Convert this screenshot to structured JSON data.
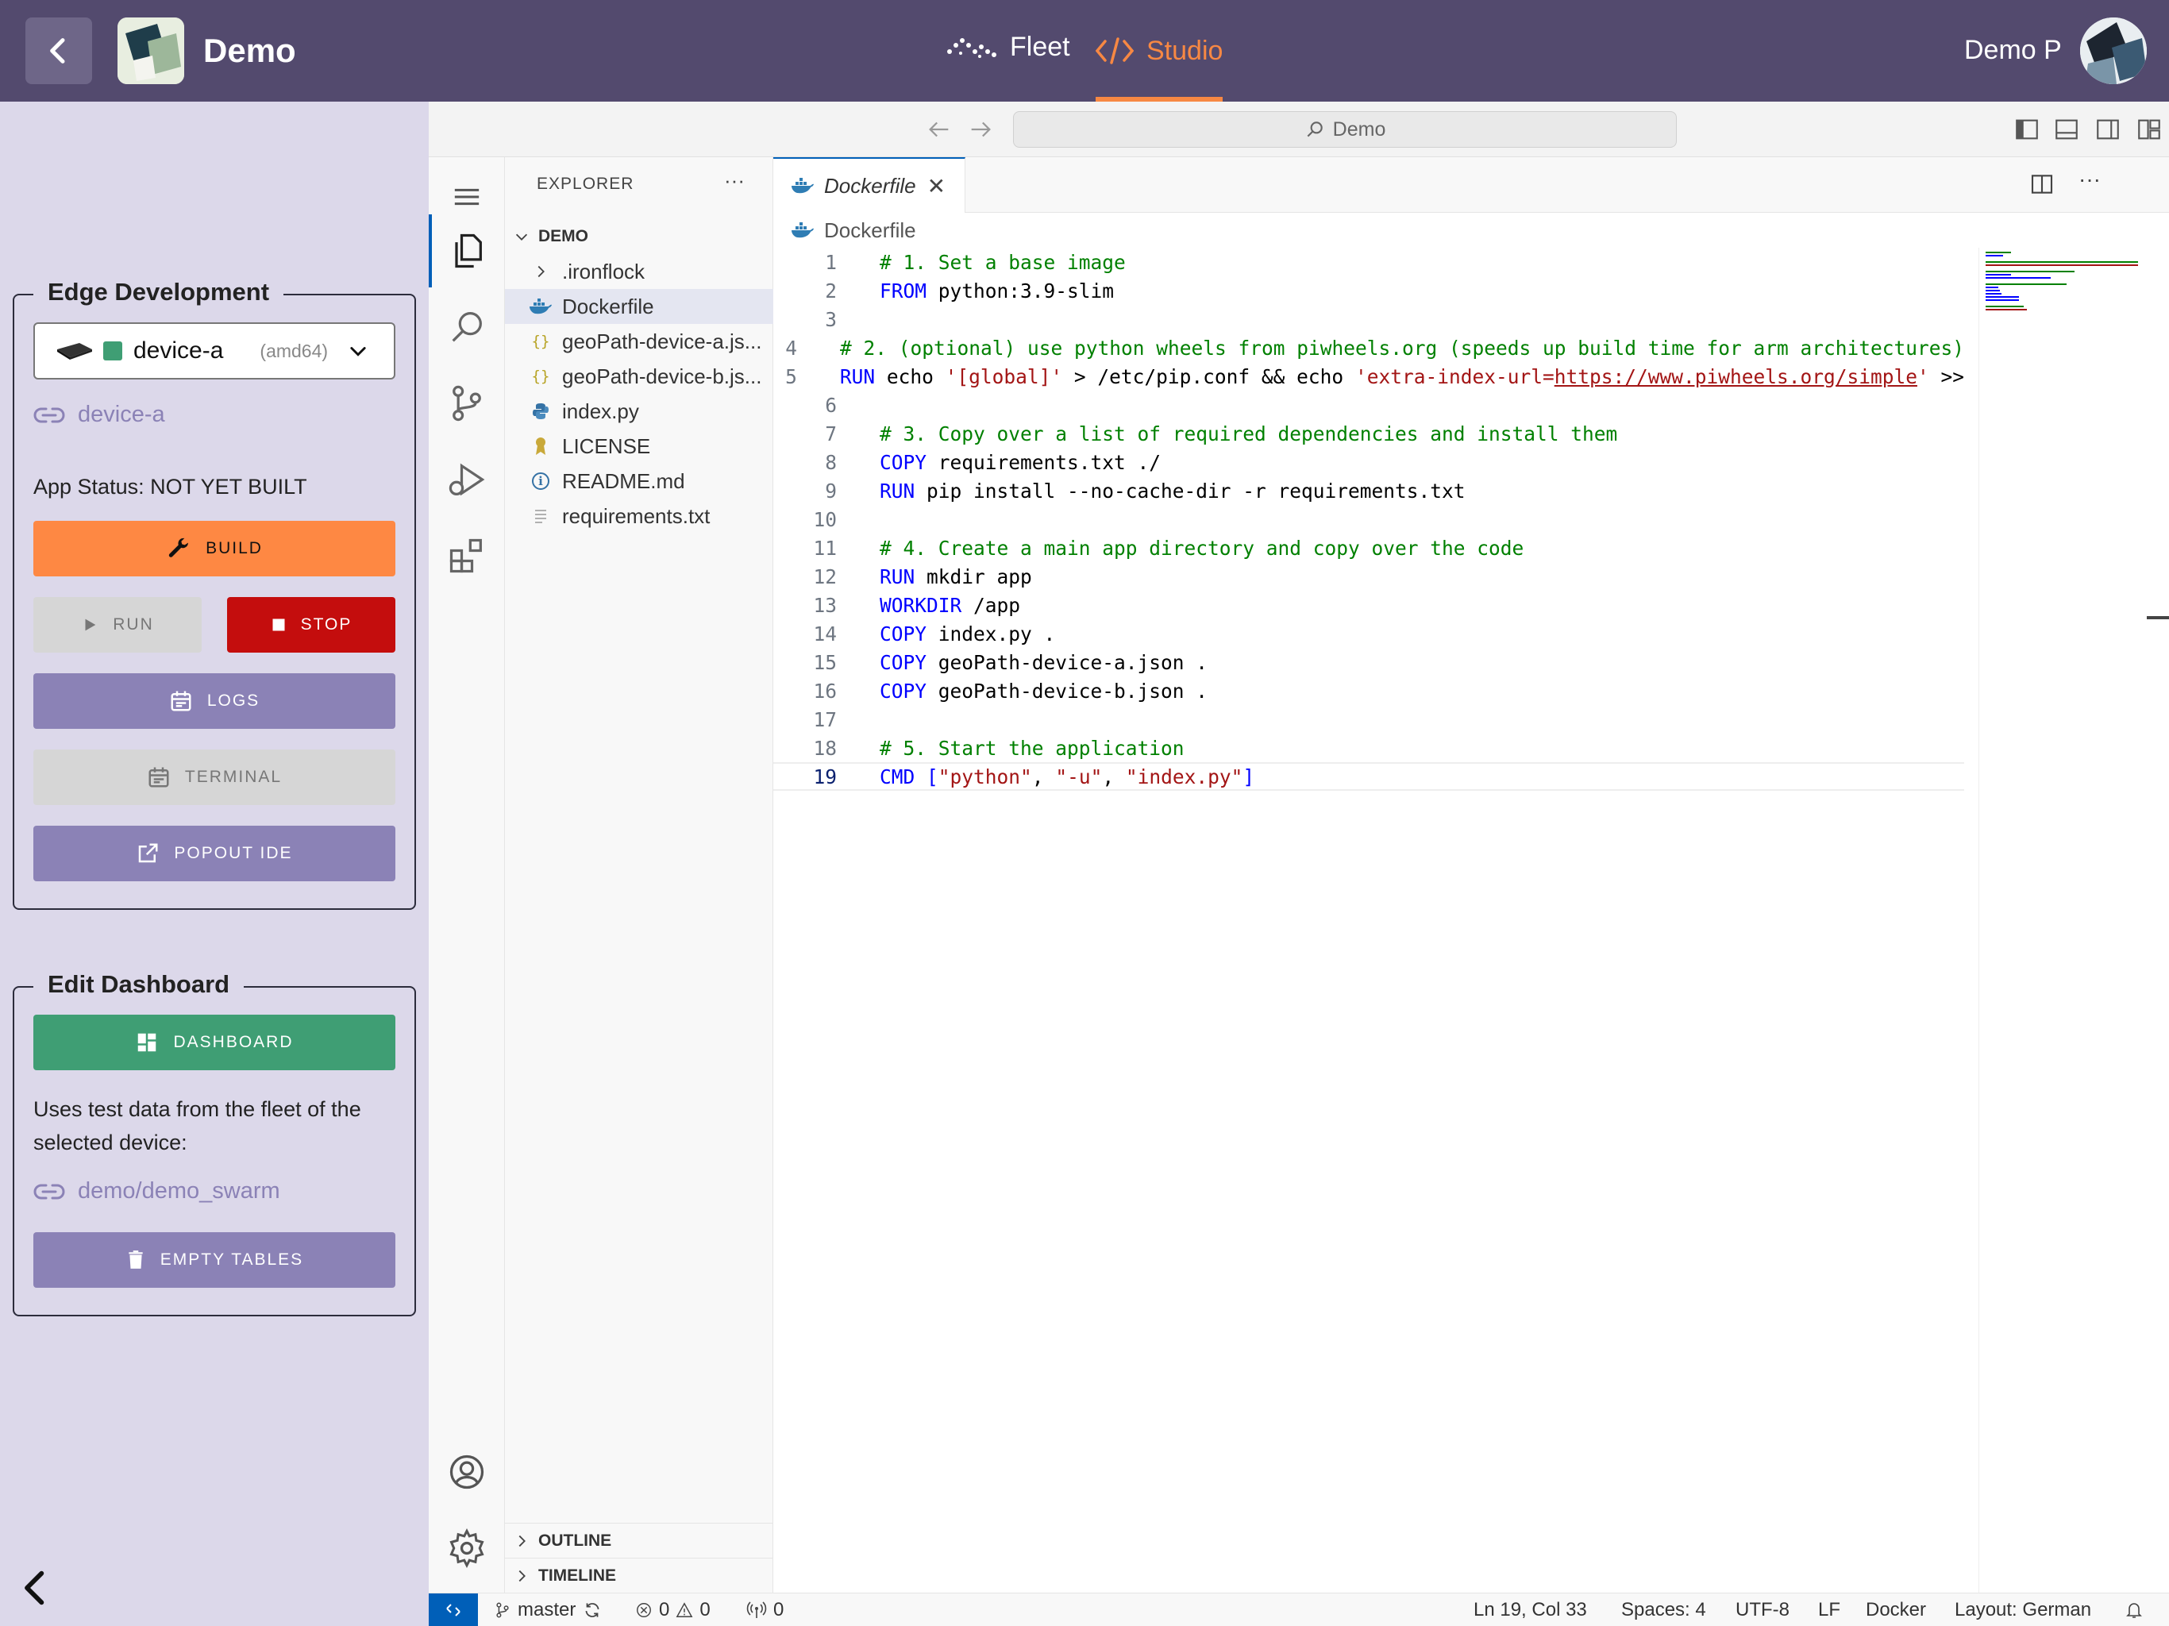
{
  "header": {
    "app_name": "Demo",
    "nav_fleet": "Fleet",
    "nav_studio": "Studio",
    "user_name": "Demo P",
    "active_color": "#f78843",
    "bar_color": "#534a6e"
  },
  "edge": {
    "title": "Edge Development",
    "device_name": "device-a",
    "device_arch": "(amd64)",
    "device_status_color": "#3f9e74",
    "device_link": "device-a",
    "app_status": "App Status: NOT YET BUILT",
    "build": "BUILD",
    "run": "RUN",
    "stop": "STOP",
    "logs": "LOGS",
    "terminal": "TERMINAL",
    "popout": "POPOUT IDE"
  },
  "dashboard": {
    "title": "Edit Dashboard",
    "button": "DASHBOARD",
    "description": "Uses test data from the fleet of the selected device:",
    "swarm_link": "demo/demo_swarm",
    "empty_tables": "EMPTY TABLES"
  },
  "ide": {
    "search_text": "Demo",
    "explorer_title": "EXPLORER",
    "explorer_more": "···",
    "folder": "DEMO",
    "files": [
      {
        "name": ".ironflock",
        "icon": "chevron-right-icon"
      },
      {
        "name": "Dockerfile",
        "icon": "docker-icon",
        "selected": true
      },
      {
        "name": "geoPath-device-a.js...",
        "icon": "json-icon"
      },
      {
        "name": "geoPath-device-b.js...",
        "icon": "json-icon"
      },
      {
        "name": "index.py",
        "icon": "python-icon"
      },
      {
        "name": "LICENSE",
        "icon": "license-icon"
      },
      {
        "name": "README.md",
        "icon": "info-icon"
      },
      {
        "name": "requirements.txt",
        "icon": "text-file-icon"
      }
    ],
    "json_glyph": "{}",
    "info_glyph": "i",
    "outline": "OUTLINE",
    "timeline": "TIMELINE",
    "tab_label": "Dockerfile",
    "tab_close": "✕",
    "editor_more": "···",
    "breadcrumb": "Dockerfile",
    "code_lines": [
      {
        "n": "1",
        "parts": [
          {
            "t": "comment",
            "s": "# 1. Set a base image"
          }
        ]
      },
      {
        "n": "2",
        "parts": [
          {
            "t": "kw",
            "s": "FROM"
          },
          {
            "t": "plain",
            "s": " python:3.9-slim"
          }
        ]
      },
      {
        "n": "3",
        "parts": []
      },
      {
        "n": "4",
        "parts": [
          {
            "t": "comment",
            "s": "# 2. (optional) use python wheels from piwheels.org (speeds up build time for arm architectures)"
          }
        ]
      },
      {
        "n": "5",
        "parts": [
          {
            "t": "kw",
            "s": "RUN"
          },
          {
            "t": "plain",
            "s": " echo "
          },
          {
            "t": "str",
            "s": "'[global]'"
          },
          {
            "t": "plain",
            "s": " > /etc/pip.conf && echo "
          },
          {
            "t": "str",
            "s": "'extra-index-url="
          },
          {
            "t": "link",
            "s": "https://www.piwheels.org/simple"
          },
          {
            "t": "str",
            "s": "'"
          },
          {
            "t": "plain",
            "s": " >>"
          }
        ]
      },
      {
        "n": "6",
        "parts": []
      },
      {
        "n": "7",
        "parts": [
          {
            "t": "comment",
            "s": "# 3. Copy over a list of required dependencies and install them"
          }
        ]
      },
      {
        "n": "8",
        "parts": [
          {
            "t": "kw",
            "s": "COPY"
          },
          {
            "t": "plain",
            "s": " requirements.txt ./"
          }
        ]
      },
      {
        "n": "9",
        "parts": [
          {
            "t": "kw",
            "s": "RUN"
          },
          {
            "t": "plain",
            "s": " pip install --no-cache-dir -r requirements.txt"
          }
        ]
      },
      {
        "n": "10",
        "parts": []
      },
      {
        "n": "11",
        "parts": [
          {
            "t": "comment",
            "s": "# 4. Create a main app directory and copy over the code"
          }
        ]
      },
      {
        "n": "12",
        "parts": [
          {
            "t": "kw",
            "s": "RUN"
          },
          {
            "t": "plain",
            "s": " mkdir app"
          }
        ]
      },
      {
        "n": "13",
        "parts": [
          {
            "t": "kw",
            "s": "WORKDIR"
          },
          {
            "t": "plain",
            "s": " /app"
          }
        ]
      },
      {
        "n": "14",
        "parts": [
          {
            "t": "kw",
            "s": "COPY"
          },
          {
            "t": "plain",
            "s": " index.py ."
          }
        ]
      },
      {
        "n": "15",
        "parts": [
          {
            "t": "kw",
            "s": "COPY"
          },
          {
            "t": "plain",
            "s": " geoPath-device-a.json ."
          }
        ]
      },
      {
        "n": "16",
        "parts": [
          {
            "t": "kw",
            "s": "COPY"
          },
          {
            "t": "plain",
            "s": " geoPath-device-b.json ."
          }
        ]
      },
      {
        "n": "17",
        "parts": []
      },
      {
        "n": "18",
        "parts": [
          {
            "t": "comment",
            "s": "# 5. Start the application"
          }
        ]
      },
      {
        "n": "19",
        "current": true,
        "parts": [
          {
            "t": "kw",
            "s": "CMD"
          },
          {
            "t": "kw",
            "s": " ["
          },
          {
            "t": "str",
            "s": "\"python\""
          },
          {
            "t": "plain",
            "s": ", "
          },
          {
            "t": "str",
            "s": "\"-u\""
          },
          {
            "t": "plain",
            "s": ", "
          },
          {
            "t": "str",
            "s": "\"index.py\""
          },
          {
            "t": "kw",
            "s": "]"
          }
        ]
      }
    ]
  },
  "statusbar": {
    "branch": "master",
    "errors": "0",
    "warnings": "0",
    "ports": "0",
    "position": "Ln 19, Col 33",
    "spaces": "Spaces: 4",
    "encoding": "UTF-8",
    "eol": "LF",
    "language": "Docker",
    "layout": "Layout: German"
  }
}
